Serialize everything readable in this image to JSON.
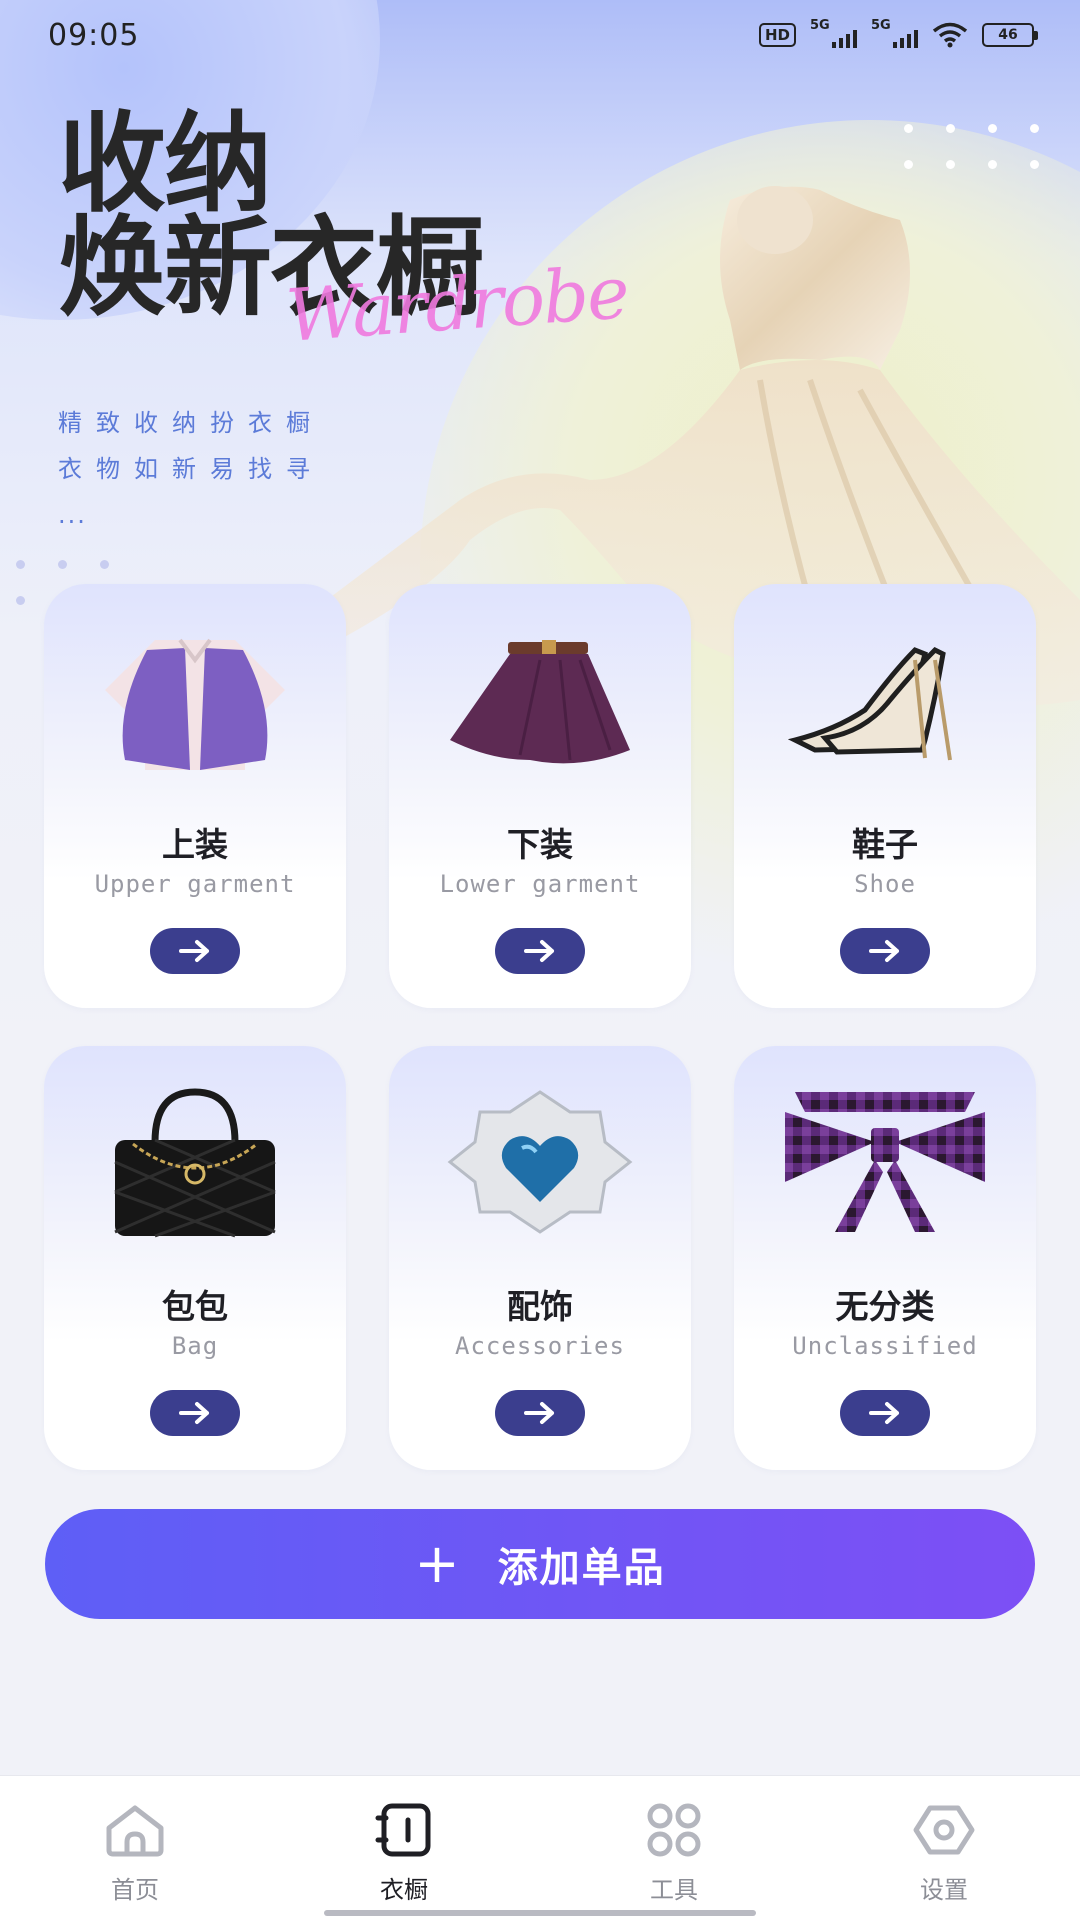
{
  "status_bar": {
    "time": "09:05",
    "hd_label": "HD",
    "signal1_label": "5G",
    "signal2_label": "5G",
    "battery_level": "46"
  },
  "hero": {
    "title_line1": "收纳",
    "title_line2": "焕新衣橱",
    "script_text": "Wardrobe",
    "subtitle_line1": "精致收纳扮衣橱",
    "subtitle_line2": "衣物如新易找寻",
    "subtitle_line3": "..."
  },
  "categories": [
    {
      "cn": "上装",
      "en": "Upper garment",
      "icon": "jacket-icon"
    },
    {
      "cn": "下装",
      "en": "Lower garment",
      "icon": "skirt-icon"
    },
    {
      "cn": "鞋子",
      "en": "Shoe",
      "icon": "heels-icon"
    },
    {
      "cn": "包包",
      "en": "Bag",
      "icon": "handbag-icon"
    },
    {
      "cn": "配饰",
      "en": "Accessories",
      "icon": "brooch-icon"
    },
    {
      "cn": "无分类",
      "en": "Unclassified",
      "icon": "bow-icon"
    }
  ],
  "add_button": {
    "plus": "+",
    "label": "添加单品"
  },
  "nav": [
    {
      "label": "首页",
      "icon": "home-icon",
      "active": false
    },
    {
      "label": "衣橱",
      "icon": "wardrobe-icon",
      "active": true
    },
    {
      "label": "工具",
      "icon": "tools-icon",
      "active": false
    },
    {
      "label": "设置",
      "icon": "settings-icon",
      "active": false
    }
  ],
  "colors": {
    "accent": "#3b3e8e",
    "button_gradient_start": "#5e5ff6",
    "button_gradient_end": "#7d4ff5",
    "script_pink": "#f07adf",
    "subtitle_blue": "#5c7bd8"
  }
}
